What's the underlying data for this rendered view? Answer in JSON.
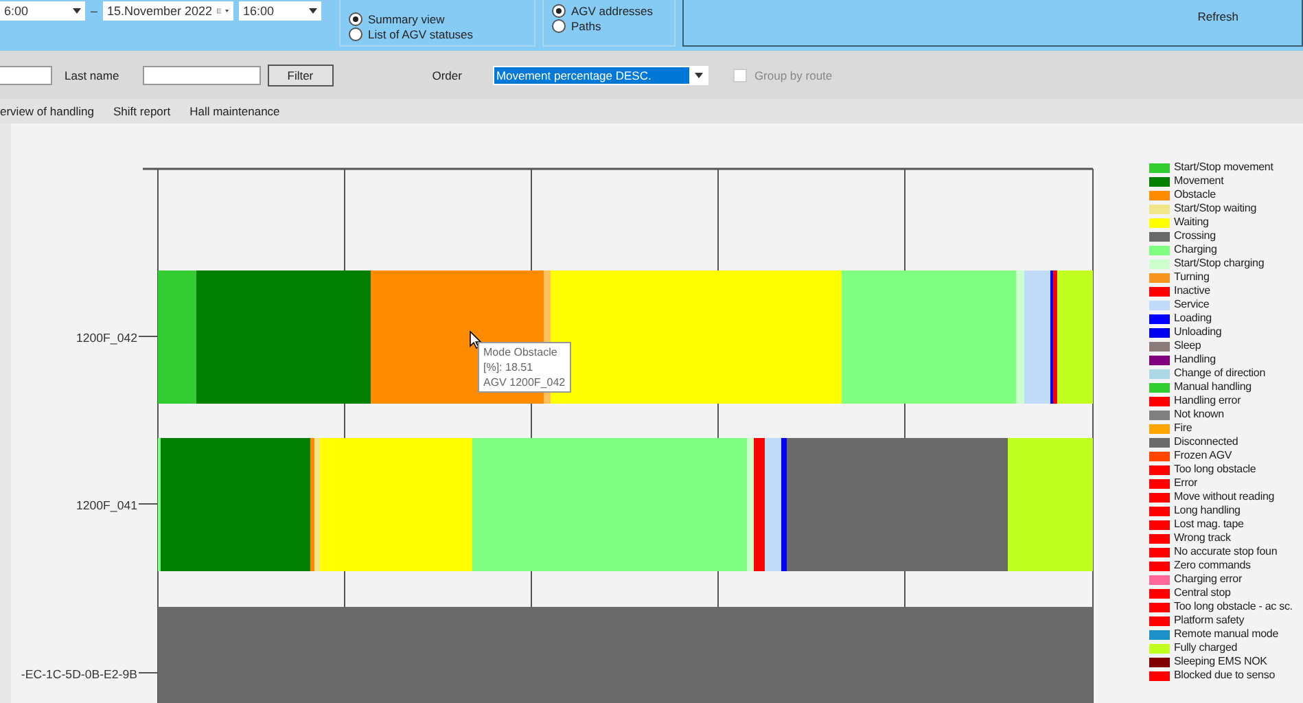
{
  "date_range": {
    "start_time": "6:00",
    "separator": "–",
    "end_date": "15.November 2022",
    "end_time": "16:00"
  },
  "view_options": [
    {
      "label": "Summary view",
      "selected": true
    },
    {
      "label": "List of AGV statuses",
      "selected": false
    }
  ],
  "map_options": [
    {
      "label": "AGV addresses",
      "selected": true
    },
    {
      "label": "Paths",
      "selected": false
    }
  ],
  "refresh_button": "Refresh",
  "filter": {
    "last_name_label": "Last name",
    "filter_button": "Filter",
    "order_label": "Order",
    "order_value": "Movement percentage DESC.",
    "group_by_route": {
      "label": "Group by route",
      "checked": false,
      "disabled": true
    }
  },
  "tabs": [
    {
      "label": "erview of handling",
      "selected": false
    },
    {
      "label": "Shift report",
      "selected": false
    },
    {
      "label": "Hall maintenance",
      "selected": false
    }
  ],
  "chart": {
    "rows": [
      {
        "label": "1200F_042"
      },
      {
        "label": "1200F_041"
      },
      {
        "label": "-EC-1C-5D-0B-E2-9B"
      }
    ],
    "tooltip": [
      "Mode Obstacle",
      "[%]: 18.51",
      "AGV 1200F_042"
    ]
  },
  "legend": [
    {
      "label": "Start/Stop movement",
      "color": "#33cc33"
    },
    {
      "label": "Movement",
      "color": "#007f00"
    },
    {
      "label": "Obstacle",
      "color": "#ff8c00"
    },
    {
      "label": "Start/Stop waiting",
      "color": "#f0e68c"
    },
    {
      "label": "Waiting",
      "color": "#ffff00"
    },
    {
      "label": "Crossing",
      "color": "#696969"
    },
    {
      "label": "Charging",
      "color": "#80ff80"
    },
    {
      "label": "Start/Stop charging",
      "color": "#ccffcc"
    },
    {
      "label": "Turning",
      "color": "#f7941d"
    },
    {
      "label": "Inactive",
      "color": "#ff0000"
    },
    {
      "label": "Service",
      "color": "#c0dcf8"
    },
    {
      "label": "Loading",
      "color": "#0000ff"
    },
    {
      "label": "Unloading",
      "color": "#0000ee"
    },
    {
      "label": "Sleep",
      "color": "#8b7b7b"
    },
    {
      "label": "Handling",
      "color": "#800080"
    },
    {
      "label": "Change of direction",
      "color": "#add8e6"
    },
    {
      "label": "Manual handling",
      "color": "#32cd32"
    },
    {
      "label": "Handling error",
      "color": "#ff0000"
    },
    {
      "label": "Not known",
      "color": "#808080"
    },
    {
      "label": "Fire",
      "color": "#ffa500"
    },
    {
      "label": "Disconnected",
      "color": "#6a6a6a"
    },
    {
      "label": "Frozen AGV",
      "color": "#ff4500"
    },
    {
      "label": "Too long obstacle",
      "color": "#ff0000"
    },
    {
      "label": "Error",
      "color": "#ff0000"
    },
    {
      "label": "Move without reading",
      "color": "#ff0000"
    },
    {
      "label": "Long handling",
      "color": "#ff0000"
    },
    {
      "label": "Lost mag. tape",
      "color": "#ff0000"
    },
    {
      "label": "Wrong track",
      "color": "#ff0000"
    },
    {
      "label": "No accurate stop foun",
      "color": "#ff0000"
    },
    {
      "label": "Zero commands",
      "color": "#ff0000"
    },
    {
      "label": "Charging error",
      "color": "#ff6699"
    },
    {
      "label": "Central stop",
      "color": "#ff0000"
    },
    {
      "label": "Too long obstacle - ac sc.",
      "color": "#ff0000"
    },
    {
      "label": "Platform safety",
      "color": "#ff0000"
    },
    {
      "label": "Remote manual mode",
      "color": "#1e90c8"
    },
    {
      "label": "Fully charged",
      "color": "#c0ff20"
    },
    {
      "label": "Sleeping EMS NOK",
      "color": "#800000"
    },
    {
      "label": "Blocked due to senso",
      "color": "#ff0000"
    }
  ]
}
